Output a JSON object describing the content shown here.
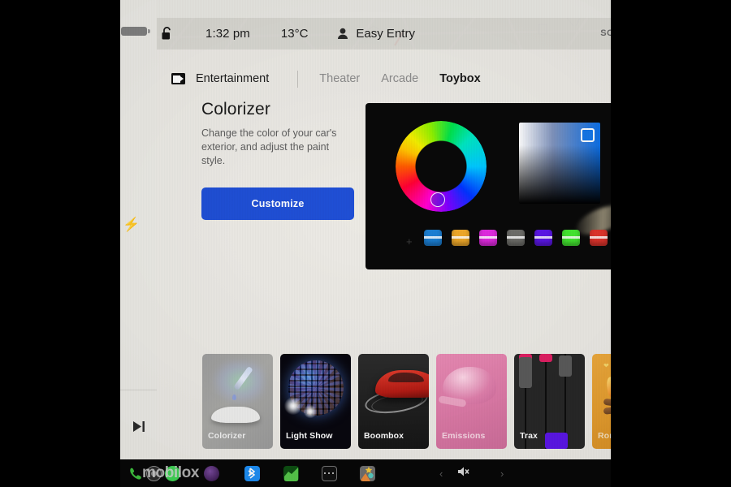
{
  "statusbar": {
    "lock_icon": "unlocked-padlock-icon",
    "time": "1:32 pm",
    "temperature": "13°C",
    "profile_icon": "person-icon",
    "profile": "Easy Entry",
    "right_clipped_text": "SO"
  },
  "left_rail": {
    "battery_icon": "battery-icon",
    "charging_icon": "lightning-bolt-icon",
    "media_next_icon": "play-next-icon"
  },
  "tabs": {
    "section_icon": "entertainment-icon",
    "section_label": "Entertainment",
    "items": [
      {
        "label": "Theater",
        "active": false
      },
      {
        "label": "Arcade",
        "active": false
      },
      {
        "label": "Toybox",
        "active": true
      }
    ]
  },
  "panel": {
    "title": "Colorizer",
    "description": "Change the color of your car's exterior, and adjust the paint style.",
    "button_label": "Customize",
    "button_color": "#1f4fd6"
  },
  "preview": {
    "wheel_label": "hue-wheel",
    "square_label": "saturation-brightness-square",
    "selected_hue": "blue",
    "swatches": [
      {
        "name": "blue",
        "color": "#1b7fd4"
      },
      {
        "name": "amber",
        "color": "#f0a92a"
      },
      {
        "name": "magenta",
        "color": "#e02ae0"
      },
      {
        "name": "gray",
        "color": "#6e6e6a"
      },
      {
        "name": "violet",
        "color": "#5b16e8"
      },
      {
        "name": "green",
        "color": "#44e831"
      },
      {
        "name": "red",
        "color": "#e0342c"
      }
    ]
  },
  "strip": {
    "items": [
      {
        "label": "Colorizer",
        "icon": "eyedropper-car-icon"
      },
      {
        "label": "Light Show",
        "icon": "disco-ball-icon"
      },
      {
        "label": "Boombox",
        "icon": "red-car-icon"
      },
      {
        "label": "Emissions",
        "icon": "whoopee-cushion-icon"
      },
      {
        "label": "Trax",
        "icon": "mixer-faders-icon"
      },
      {
        "label": "Romance",
        "icon": "campfire-icon"
      }
    ]
  },
  "taskbar": {
    "watermark": "mobilox",
    "apps": [
      {
        "name": "phone-icon",
        "color": "#3ec03e"
      },
      {
        "name": "dark-disc-icon",
        "color": "#2b2b2b"
      },
      {
        "name": "spotify-icon",
        "color": "#3fd254"
      },
      {
        "name": "purple-disc-icon",
        "color": "#4b2464"
      },
      {
        "name": "bluetooth-icon",
        "color": "#1d8ef5"
      },
      {
        "name": "chart-app-icon",
        "color": "#176b1d"
      },
      {
        "name": "more-icon",
        "color": "#161616"
      },
      {
        "name": "gallery-icon",
        "color": "#6b6b6b"
      }
    ],
    "nav_back": "‹",
    "nav_forward": "›",
    "volume_icon": "volume-mute-icon"
  }
}
